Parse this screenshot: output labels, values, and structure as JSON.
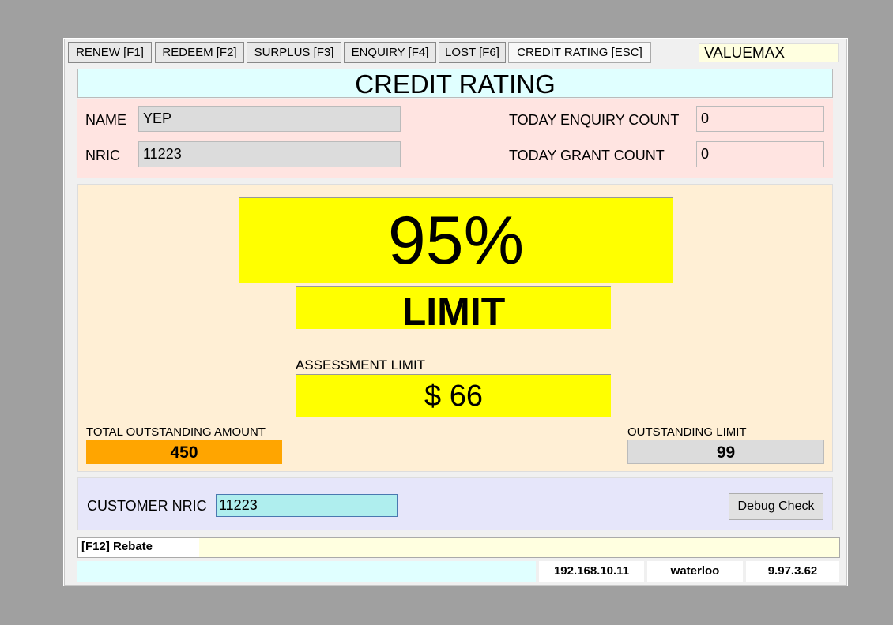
{
  "tabs": [
    {
      "label": "RENEW  [F1]"
    },
    {
      "label": "REDEEM [F2]"
    },
    {
      "label": "SURPLUS [F3]"
    },
    {
      "label": "ENQUIRY [F4]"
    },
    {
      "label": "LOST [F6]"
    },
    {
      "label": "CREDIT RATING [ESC]"
    }
  ],
  "brand": "VALUEMAX",
  "title": "CREDIT RATING",
  "customer": {
    "name_label": "NAME",
    "name": "YEP",
    "nric_label": "NRIC",
    "nric": "11223",
    "enquiry_label": "TODAY ENQUIRY COUNT",
    "enquiry": "0",
    "grant_label": "TODAY GRANT COUNT",
    "grant": "0"
  },
  "rating": {
    "percent": "95%",
    "status": "LIMIT",
    "assessment_label": "ASSESSMENT LIMIT",
    "assessment": "$ 66",
    "total_outstanding_label": "TOTAL OUTSTANDING AMOUNT",
    "total_outstanding": "450",
    "outstanding_limit_label": "OUTSTANDING LIMIT",
    "outstanding_limit": "99"
  },
  "search": {
    "label": "CUSTOMER NRIC",
    "value": "11223",
    "debug_button": "Debug Check"
  },
  "status": {
    "hotkey": "[F12] Rebate",
    "ip": "192.168.10.11",
    "location": "waterloo",
    "version": "9.97.3.62"
  }
}
